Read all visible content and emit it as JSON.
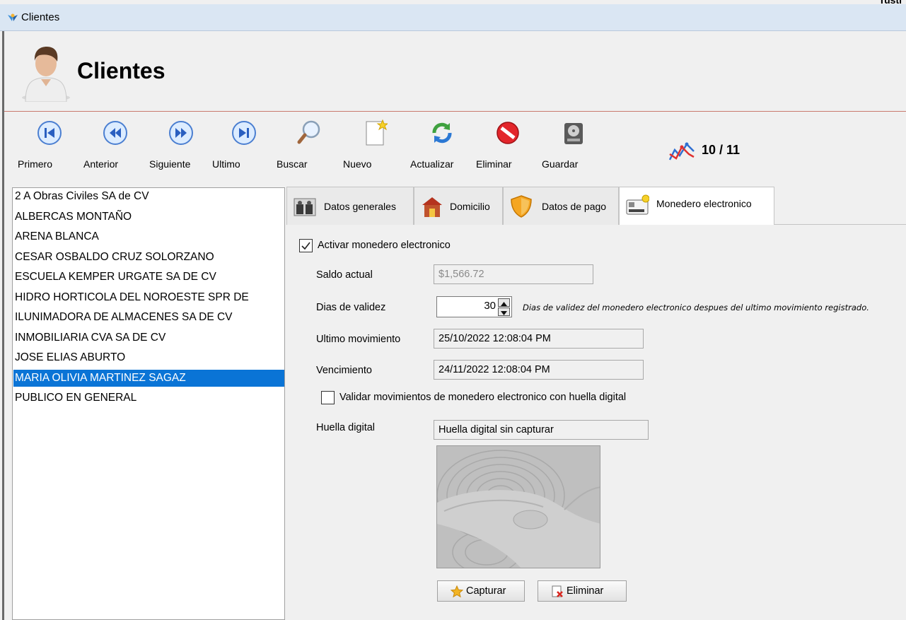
{
  "window": {
    "title": "Clientes",
    "corner_text": "Tusti"
  },
  "header": {
    "title": "Clientes"
  },
  "toolbar": {
    "first_label": "Primero",
    "previous_label": "Anterior",
    "next_label": "Siguiente",
    "last_label": "Ultimo",
    "search_label": "Buscar",
    "new_label": "Nuevo",
    "refresh_label": "Actualizar",
    "delete_label": "Eliminar",
    "save_label": "Guardar",
    "record_counter": "10 / 11"
  },
  "clients": {
    "items": [
      "2 A Obras Civiles SA de CV",
      "ALBERCAS MONTAÑO",
      "ARENA BLANCA",
      "CESAR OSBALDO CRUZ SOLORZANO",
      "ESCUELA KEMPER URGATE SA DE CV",
      "HIDRO HORTICOLA DEL NOROESTE SPR DE",
      "ILUNIMADORA DE ALMACENES SA DE CV",
      "INMOBILIARIA CVA SA DE CV",
      "JOSE ELIAS ABURTO",
      "MARIA OLIVIA MARTINEZ SAGAZ",
      "PUBLICO EN GENERAL"
    ],
    "selected_index": 9
  },
  "tabs": {
    "general": "Datos generales",
    "address": "Domicilio",
    "payment": "Datos de pago",
    "wallet": "Monedero electronico",
    "active": "wallet"
  },
  "wallet": {
    "activate_label": "Activar monedero electronico",
    "activate_checked": true,
    "balance_label": "Saldo actual",
    "balance_value": "$1,566.72",
    "validity_label": "Dias de validez",
    "validity_value": "30",
    "validity_hint": "Dias de validez del monedero electronico despues del ultimo movimiento registrado.",
    "last_movement_label": "Ultimo movimiento",
    "last_movement_value": "25/10/2022 12:08:04 PM",
    "expiration_label": "Vencimiento",
    "expiration_value": "24/11/2022 12:08:04 PM",
    "fingerprint_check_label": "Validar movimientos de monedero electronico con huella digital",
    "fingerprint_check_checked": false,
    "fingerprint_label": "Huella digital",
    "fingerprint_status": "Huella digital sin capturar",
    "capture_button": "Capturar",
    "delete_button": "Eliminar"
  },
  "colors": {
    "selection": "#0a74d6",
    "titlebar": "#dae6f3",
    "header_rule": "#c97a6e"
  }
}
